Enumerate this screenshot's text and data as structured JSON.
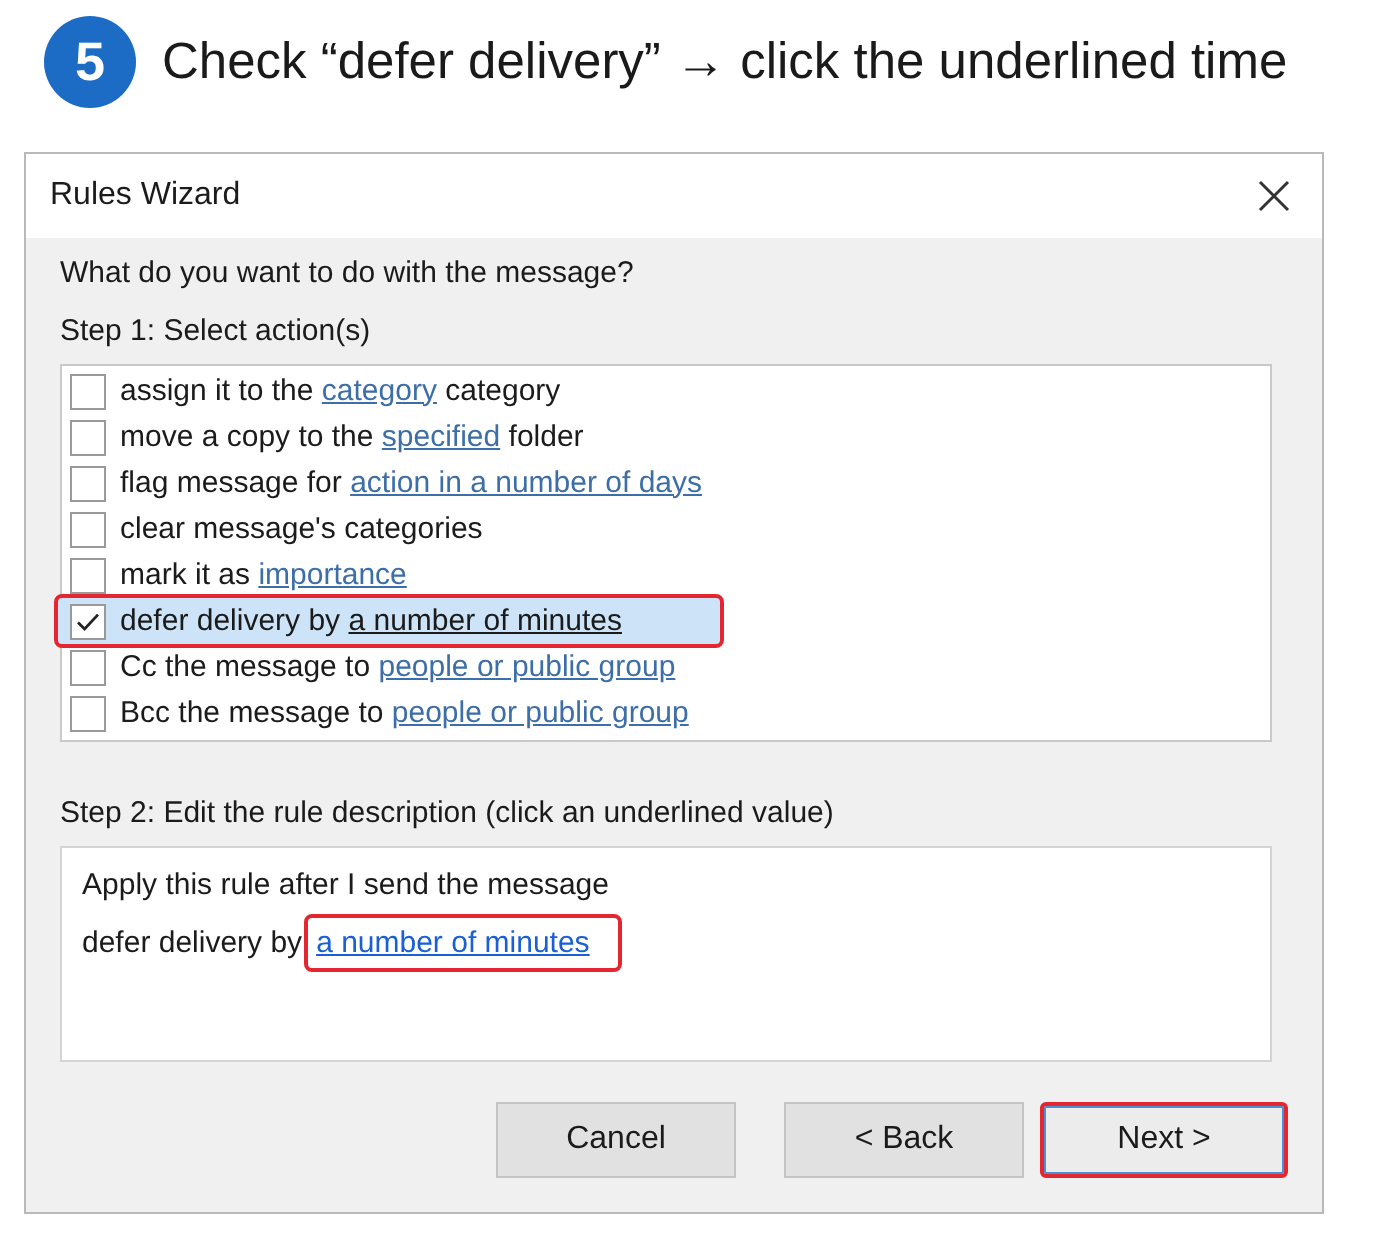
{
  "step": {
    "number": "5",
    "instruction": "Check “defer delivery” → click the underlined time"
  },
  "dialog": {
    "title": "Rules Wizard",
    "question": "What do you want to do with the message?",
    "step1_label": "Step 1: Select action(s)",
    "actions": [
      {
        "text": "assign it to the ",
        "link": "category",
        "after": " category",
        "checked": false,
        "selected": false,
        "highlighted": false
      },
      {
        "text": "move a copy to the ",
        "link": "specified",
        "after": " folder",
        "checked": false,
        "selected": false,
        "highlighted": false
      },
      {
        "text": "flag message for ",
        "link": "action in a number of days",
        "checked": false,
        "selected": false,
        "highlighted": false
      },
      {
        "text": "clear message's categories",
        "checked": false,
        "selected": false,
        "highlighted": false
      },
      {
        "text": "mark it as ",
        "link": "importance",
        "checked": false,
        "selected": false,
        "highlighted": false
      },
      {
        "text": "defer delivery by ",
        "link": "a number of minutes",
        "checked": true,
        "selected": true,
        "highlighted": true
      },
      {
        "text": "Cc the message to ",
        "link": "people or public group",
        "checked": false,
        "selected": false,
        "highlighted": false
      },
      {
        "text": "Bcc the message to ",
        "link": "people or public group",
        "checked": false,
        "selected": false,
        "highlighted": false
      }
    ],
    "step2_label": "Step 2: Edit the rule description (click an underlined value)",
    "description": [
      {
        "text": "Apply this rule after I send the message",
        "highlighted": false
      },
      {
        "text": "defer delivery by",
        "link": "a number of minutes",
        "highlighted": true
      }
    ],
    "buttons": [
      {
        "label": "Cancel",
        "default": false,
        "highlighted": false
      },
      {
        "label": "< Back",
        "default": false,
        "highlighted": false
      },
      {
        "label": "Next >",
        "default": true,
        "highlighted": true
      }
    ]
  }
}
